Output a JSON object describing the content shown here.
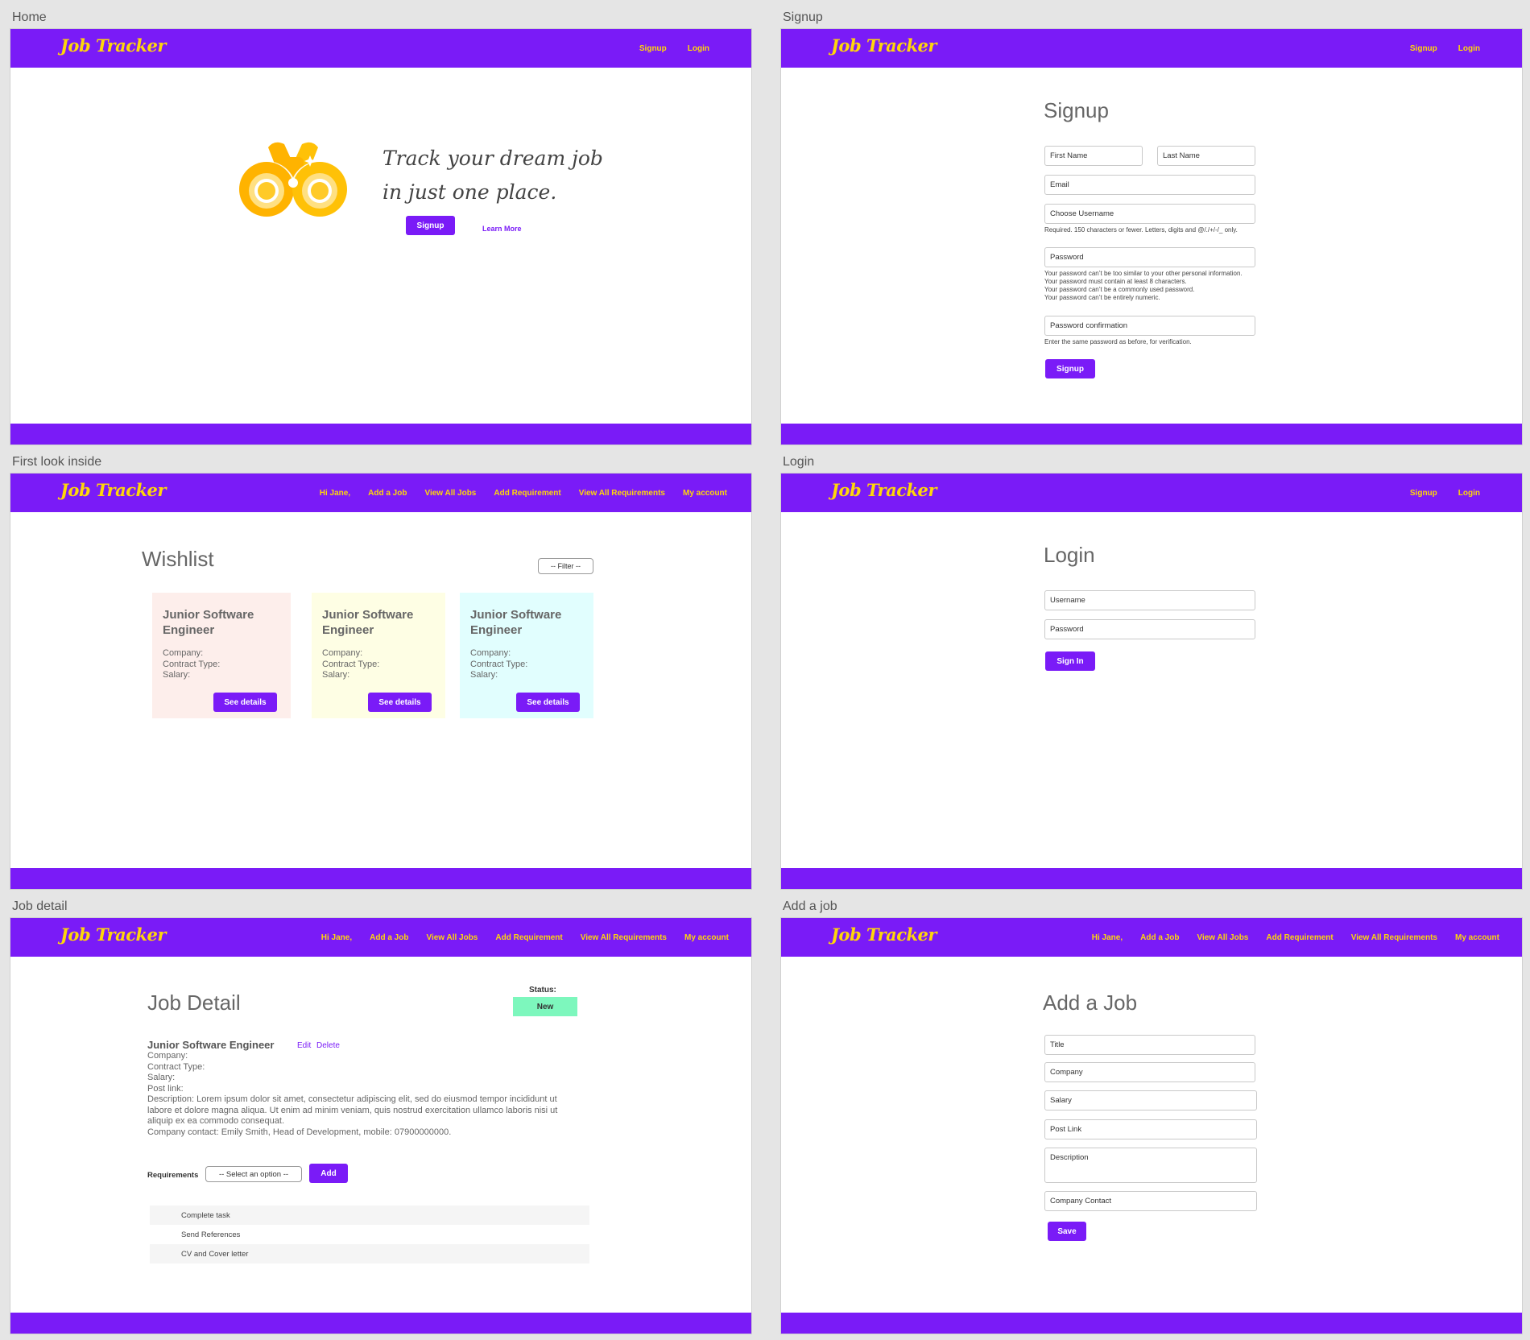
{
  "brand": {
    "logo": "Job Tracker",
    "primary": "#7a1bf7",
    "accent": "#ffd60a"
  },
  "nav_guest": {
    "signup": "Signup",
    "login": "Login"
  },
  "nav_user": {
    "greeting": "Hi Jane,",
    "add_job": "Add a Job",
    "view_jobs": "View All Jobs",
    "add_req": "Add Requirement",
    "view_reqs": "View All Requirements",
    "account": "My account"
  },
  "boards": {
    "home": "Home",
    "signup": "Signup",
    "first_look": "First look inside",
    "login": "Login",
    "job_detail": "Job detail",
    "add_job": "Add a job"
  },
  "home": {
    "tagline_1": "Track your dream job",
    "tagline_2": "in just one place.",
    "signup_button": "Signup",
    "learn_more": "Learn More"
  },
  "signup": {
    "title": "Signup",
    "first_name": "First Name",
    "last_name": "Last Name",
    "email": "Email",
    "username": "Choose Username",
    "username_help": "Required. 150 characters or fewer. Letters, digits and @/./+/-/_ only.",
    "password": "Password",
    "password_help": [
      "Your password can’t be too similar to your other personal information.",
      "Your password must contain at least 8 characters.",
      "Your password can’t be a commonly used password.",
      "Your password can’t be entirely numeric."
    ],
    "password_confirm": "Password confirmation",
    "confirm_help": "Enter the same password as before, for verification.",
    "submit": "Signup"
  },
  "wishlist": {
    "title": "Wishlist",
    "filter": "-- Filter --",
    "cards": [
      {
        "title": "Junior Software Engineer",
        "company": "Company:",
        "contract": "Contract Type:",
        "salary": "Salary:",
        "button": "See details",
        "color": "#fdeeeb"
      },
      {
        "title": "Junior Software Engineer",
        "company": "Company:",
        "contract": "Contract Type:",
        "salary": "Salary:",
        "button": "See details",
        "color": "#fefee4"
      },
      {
        "title": "Junior Software Engineer",
        "company": "Company:",
        "contract": "Contract Type:",
        "salary": "Salary:",
        "button": "See details",
        "color": "#e1fefe"
      }
    ]
  },
  "login": {
    "title": "Login",
    "username": "Username",
    "password": "Password",
    "submit": "Sign In"
  },
  "job_detail": {
    "title": "Job Detail",
    "status_label": "Status:",
    "status": "New",
    "status_color": "#7df7bd",
    "job_title": "Junior Software Engineer",
    "edit": "Edit",
    "delete": "Delete",
    "company": "Company:",
    "contract": "Contract Type:",
    "salary": "Salary:",
    "post_link": "Post link:",
    "description": "Description: Lorem ipsum dolor sit amet, consectetur adipiscing elit, sed do eiusmod tempor incididunt ut labore et dolore magna aliqua. Ut enim ad minim veniam, quis nostrud exercitation ullamco laboris nisi ut aliquip ex ea commodo consequat.",
    "contact": "Company contact: Emily Smith, Head of Development, mobile: 07900000000.",
    "requirements_label": "Requirements",
    "select_placeholder": "-- Select an option --",
    "add_button": "Add",
    "requirements": [
      "Complete task",
      "Send References",
      "CV and Cover letter"
    ]
  },
  "add_job": {
    "title": "Add a Job",
    "fields": {
      "title": "Title",
      "company": "Company",
      "salary": "Salary",
      "post_link": "Post Link",
      "description": "Description",
      "contact": "Company Contact"
    },
    "save": "Save"
  }
}
